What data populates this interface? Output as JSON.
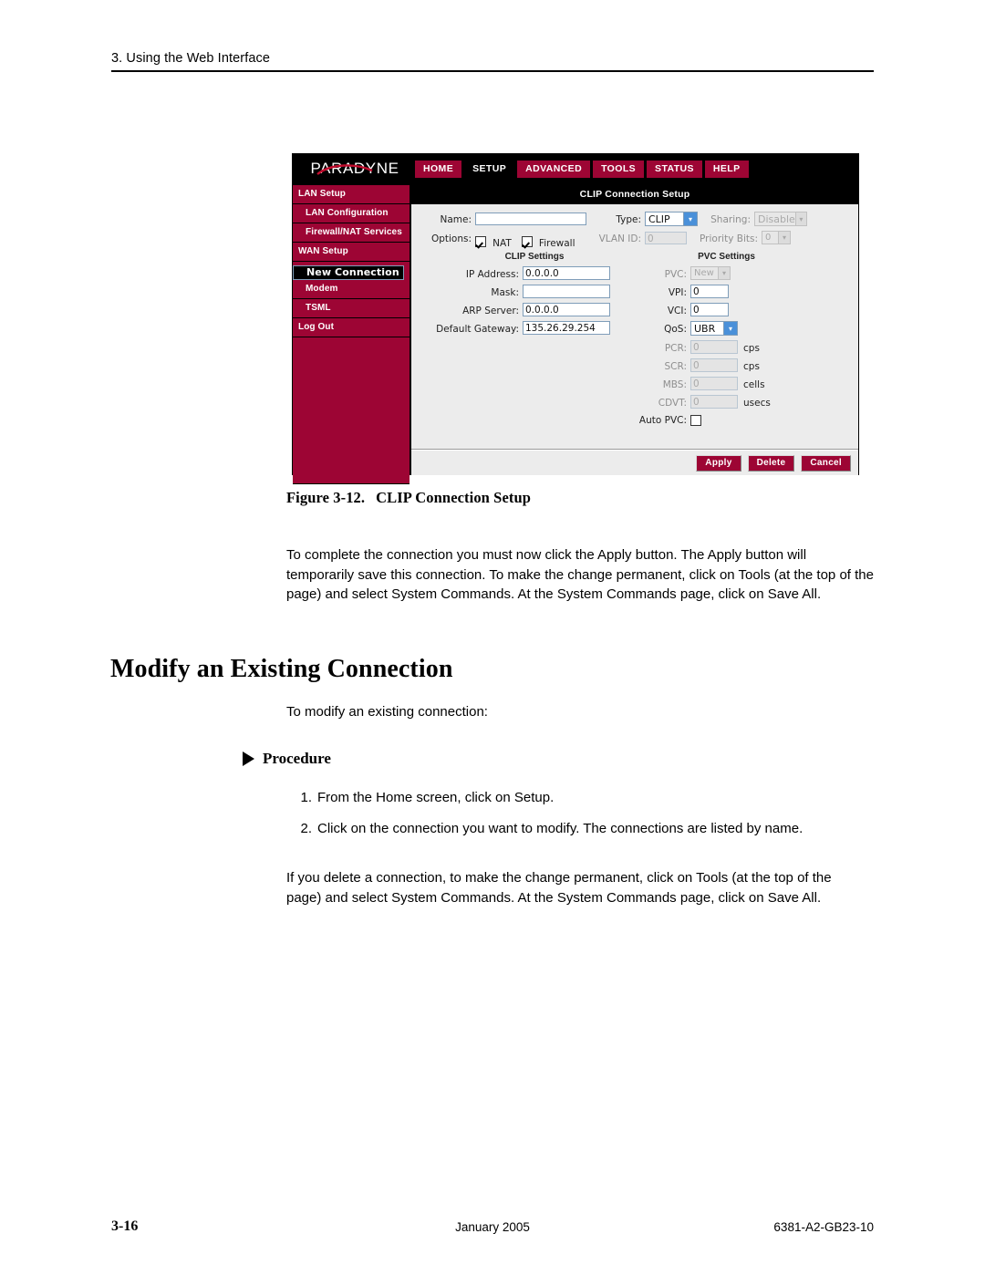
{
  "page": {
    "header_text": "3. Using the Web Interface",
    "footer": {
      "page_number": "3-16",
      "date": "January 2005",
      "doc_number": "6381-A2-GB23-10"
    }
  },
  "figure": {
    "caption_number": "Figure 3-12.",
    "caption_title": "CLIP Connection Setup",
    "webui": {
      "brand": "PARADYNE",
      "nav": [
        {
          "label": "HOME",
          "active": false
        },
        {
          "label": "SETUP",
          "active": true
        },
        {
          "label": "ADVANCED",
          "active": false
        },
        {
          "label": "TOOLS",
          "active": false
        },
        {
          "label": "STATUS",
          "active": false
        },
        {
          "label": "HELP",
          "active": false
        }
      ],
      "sidebar": [
        {
          "label": "LAN Setup",
          "indent": false,
          "selected": false
        },
        {
          "label": "LAN Configuration",
          "indent": true,
          "selected": false
        },
        {
          "label": "Firewall/NAT Services",
          "indent": true,
          "selected": false
        },
        {
          "label": "WAN Setup",
          "indent": false,
          "selected": false
        },
        {
          "label": "New Connection",
          "indent": true,
          "selected": true
        },
        {
          "label": "Modem",
          "indent": true,
          "selected": false
        },
        {
          "label": "TSML",
          "indent": true,
          "selected": false
        },
        {
          "label": "Log Out",
          "indent": false,
          "selected": false
        }
      ],
      "panel_title": "CLIP Connection Setup",
      "top_form": {
        "name_label": "Name:",
        "name_value": "",
        "options_label": "Options:",
        "nat_label": "NAT",
        "nat_checked": true,
        "firewall_label": "Firewall",
        "firewall_checked": true,
        "type_label": "Type:",
        "type_value": "CLIP",
        "vlan_id_label": "VLAN ID:",
        "vlan_id_value": "0",
        "sharing_label": "Sharing:",
        "sharing_value": "Disable",
        "priority_bits_label": "Priority Bits:",
        "priority_bits_value": "0"
      },
      "clip_settings": {
        "heading": "CLIP Settings",
        "rows": [
          {
            "label": "IP Address:",
            "value": "0.0.0.0"
          },
          {
            "label": "Mask:",
            "value": ""
          },
          {
            "label": "ARP Server:",
            "value": "0.0.0.0"
          },
          {
            "label": "Default Gateway:",
            "value": "135.26.29.254"
          }
        ]
      },
      "pvc_settings": {
        "heading": "PVC Settings",
        "pvc_label": "PVC:",
        "pvc_value": "New",
        "vpi_label": "VPI:",
        "vpi_value": "0",
        "vci_label": "VCI:",
        "vci_value": "0",
        "qos_label": "QoS:",
        "qos_value": "UBR",
        "pcr_label": "PCR:",
        "pcr_value": "0",
        "pcr_unit": "cps",
        "scr_label": "SCR:",
        "scr_value": "0",
        "scr_unit": "cps",
        "mbs_label": "MBS:",
        "mbs_value": "0",
        "mbs_unit": "cells",
        "cdvt_label": "CDVT:",
        "cdvt_value": "0",
        "cdvt_unit": "usecs",
        "auto_pvc_label": "Auto PVC:",
        "auto_pvc_checked": false
      },
      "buttons": [
        {
          "label": "Apply"
        },
        {
          "label": "Delete"
        },
        {
          "label": "Cancel"
        }
      ]
    }
  },
  "content": {
    "paragraph_1": "To complete the connection you must now click the Apply button. The Apply button will temporarily save this connection. To make the change permanent, click on Tools (at the top of the page) and select System Commands. At the System Commands page, click on Save All.",
    "section_title": "Modify an Existing Connection",
    "lead_line": "To modify an existing connection:",
    "procedure_heading": "Procedure",
    "procedure_steps": [
      {
        "num": "1.",
        "text": "From the Home screen, click on Setup."
      },
      {
        "num": "2.",
        "text": "Click on the connection you want to modify. The connections are listed by name."
      }
    ],
    "paragraph_3": "If you delete a connection, to make the change permanent, click on Tools (at the top of the page) and select System Commands. At the System Commands page, click on Save All."
  },
  "colors": {
    "brand_red": "#9d0534",
    "black": "#000000",
    "panel_gray": "#ececec",
    "field_border": "#7f9db9"
  }
}
